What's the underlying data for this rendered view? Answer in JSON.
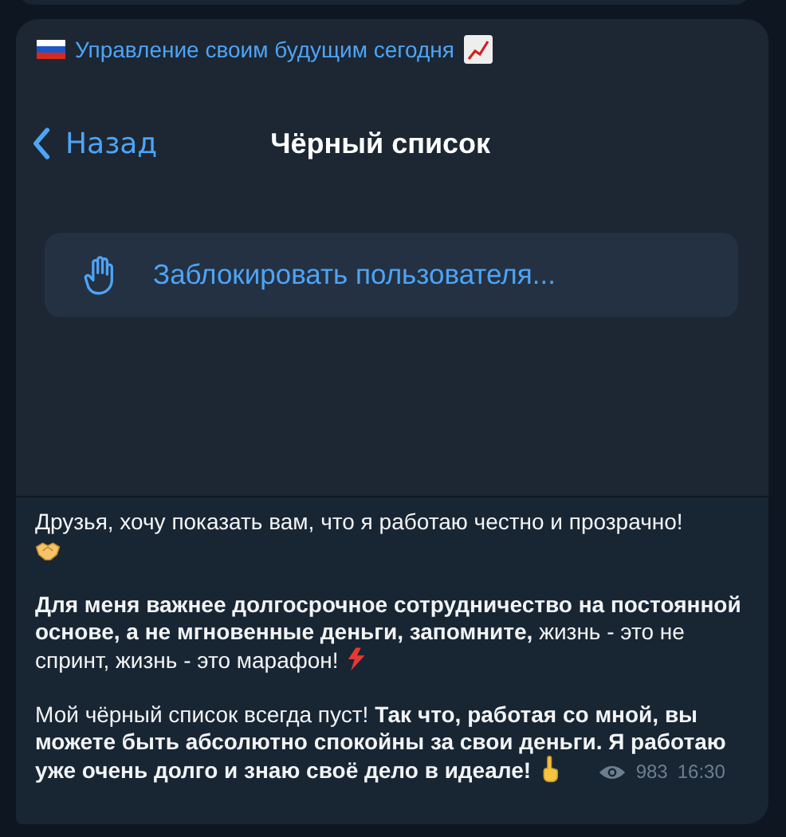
{
  "channel": {
    "name": "Управление своим будущим сегодня"
  },
  "screen": {
    "back": "Назад",
    "title": "Чёрный список",
    "action": "Заблокировать пользователя..."
  },
  "message": {
    "paragraphs": [
      {
        "text": "Друзья, хочу показать вам, что я работаю честно и прозрачно!",
        "kind": "handshake"
      },
      {
        "text": "**Для меня важнее долгосрочное сотрудничество на постоянной основе, а не мгновенные деньги, запомните,** жизнь - это не спринт, жизнь - это марафон!",
        "kind": "lightning"
      },
      {
        "text": "Мой чёрный список всегда пуст! **Так что, работая со мной, вы можете быть абсолютно спокойны за свои деньги. Я работаю уже очень долго и знаю своё дело в идеале!**",
        "kind": "finger"
      }
    ],
    "views": "983",
    "time": "16:30"
  }
}
